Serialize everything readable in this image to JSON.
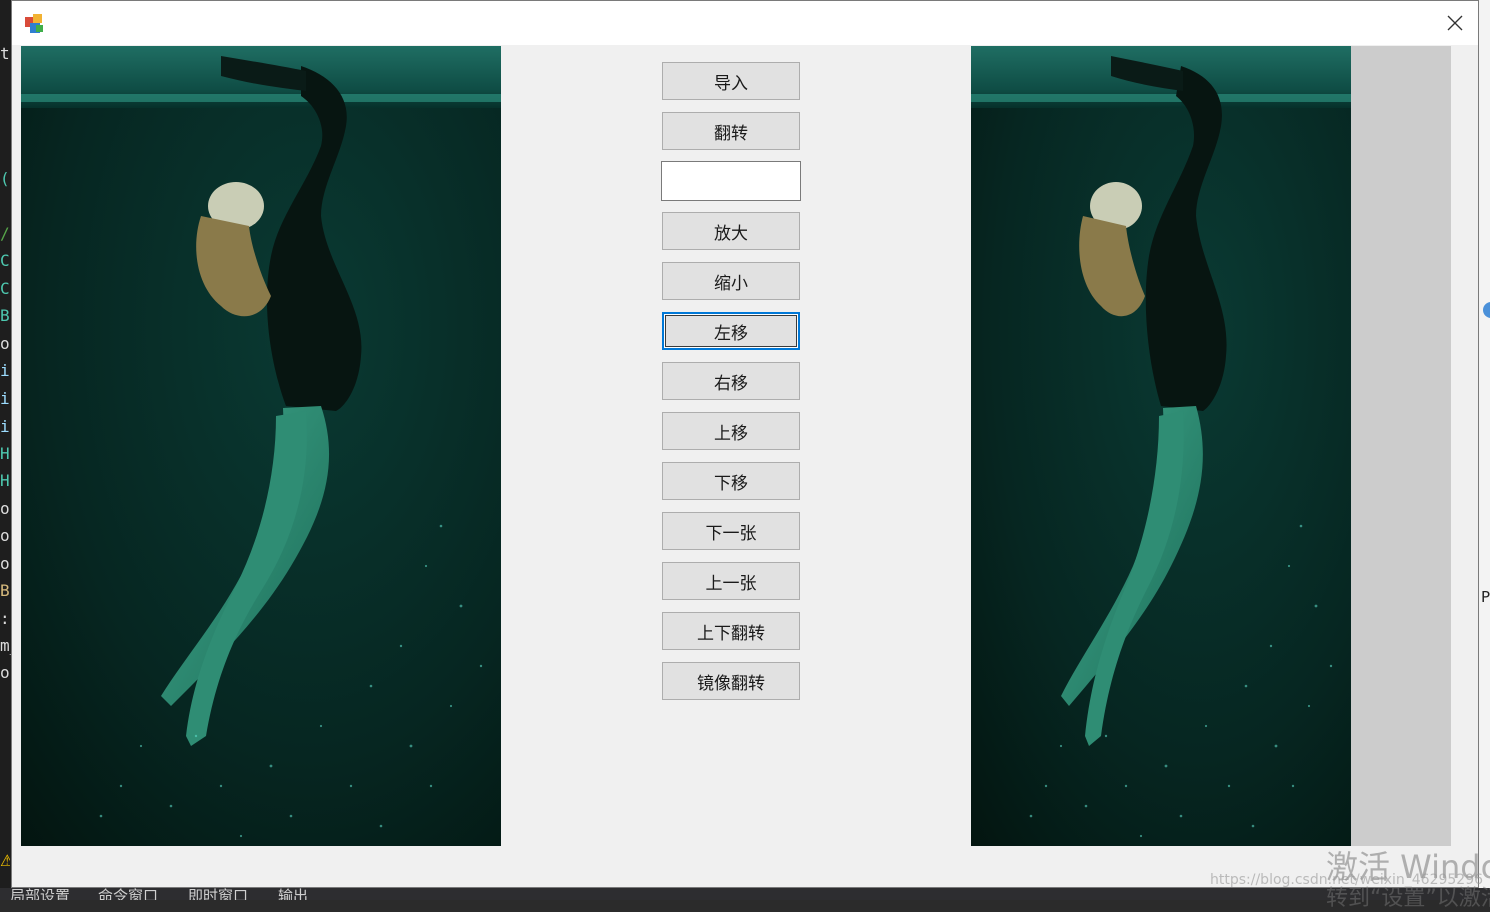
{
  "ide_background": {
    "left_fragments": [
      "tr",
      "(",
      "/",
      "C",
      "C:",
      "B",
      "or",
      "i",
      "i",
      "i",
      "H",
      "H",
      "or",
      "or",
      "or",
      "B",
      ":",
      "m_",
      "or"
    ],
    "bottom_tabs": [
      "局部设置",
      "命令窗口",
      "即时窗口",
      "输出"
    ],
    "right_letter": "P"
  },
  "window": {
    "close_icon": "close-icon",
    "app_icon": "app-icon"
  },
  "buttons": {
    "import": "导入",
    "flip": "翻转",
    "zoom_in": "放大",
    "zoom_out": "缩小",
    "move_left": "左移",
    "move_right": "右移",
    "move_up": "上移",
    "move_down": "下移",
    "next_image": "下一张",
    "prev_image": "上一张",
    "vertical_flip": "上下翻转",
    "mirror_flip": "镜像翻转"
  },
  "input": {
    "value": "",
    "placeholder": ""
  },
  "watermark": {
    "activate": "激活 Windo",
    "url": "https://blog.csdn.net/weixin_46295296",
    "sub": "转到“设置”以激活"
  },
  "colors": {
    "water_dark": "#041a17",
    "water_teal": "#0b5a4e",
    "focus_blue": "#0078d7"
  }
}
